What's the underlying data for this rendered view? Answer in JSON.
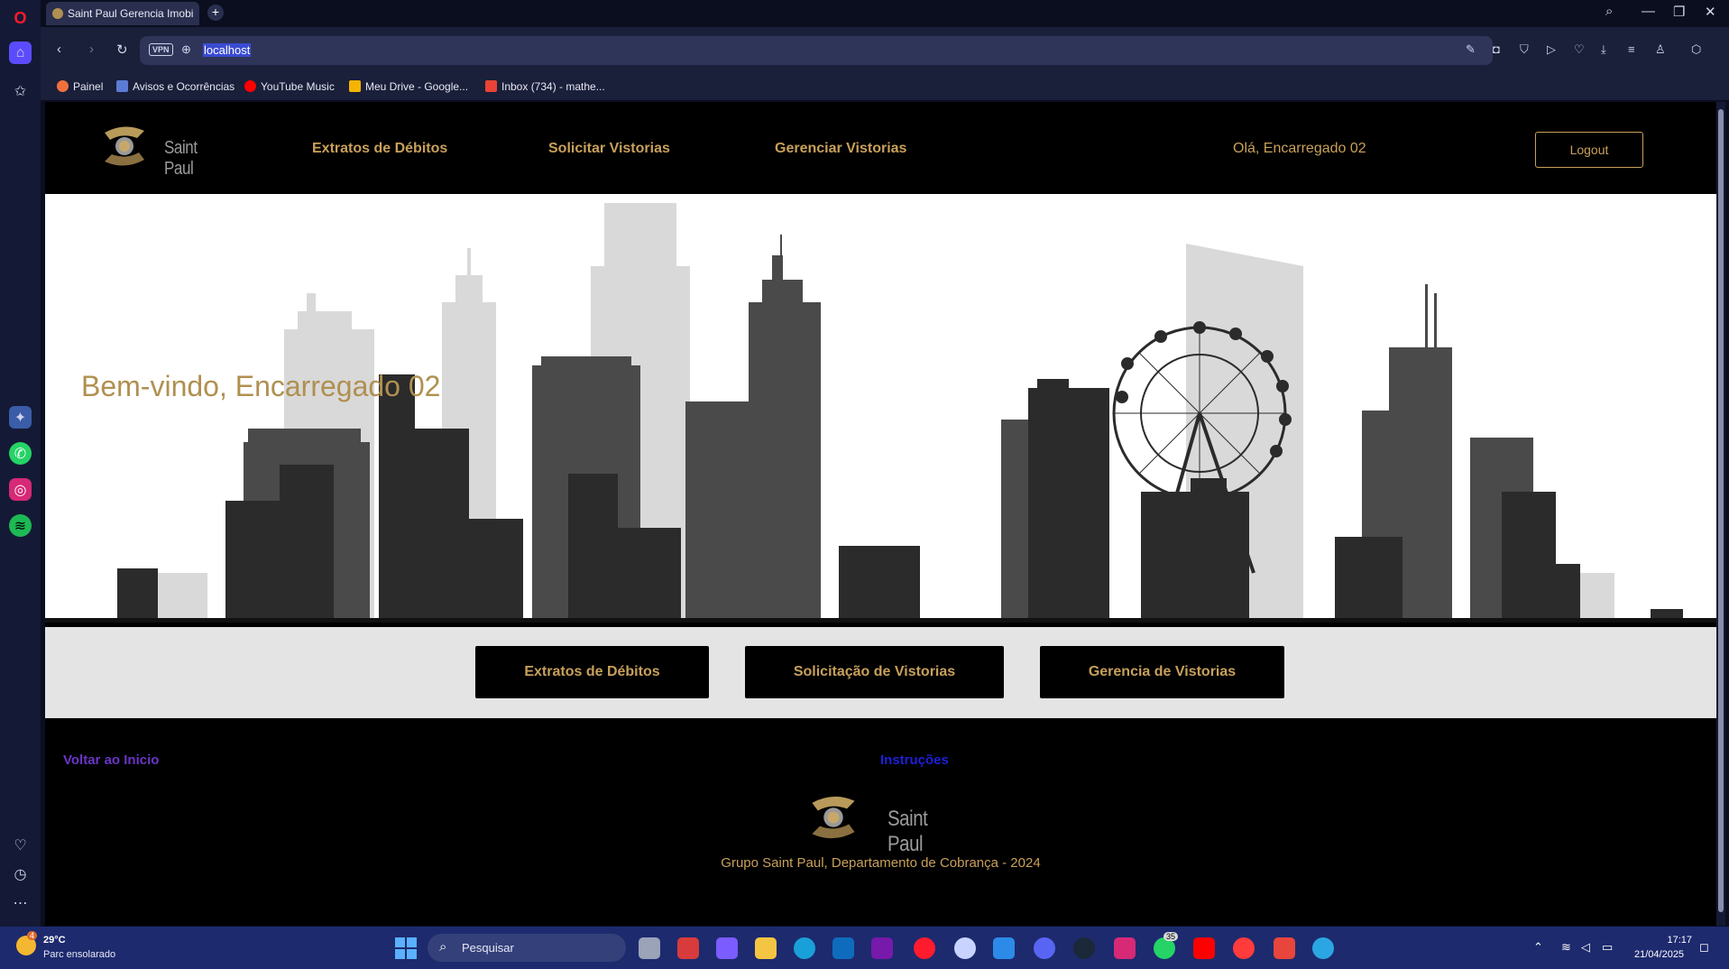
{
  "browser": {
    "tab_title": "Saint Paul Gerencia Imobi",
    "url": "localhost",
    "vpn_label": "VPN",
    "bookmarks": [
      "Painel",
      "Avisos e Ocorrências",
      "YouTube Music",
      "Meu Drive - Google...",
      "Inbox (734) - mathe..."
    ]
  },
  "header": {
    "logo_text": "Saint Paul",
    "nav": [
      "Extratos de Débitos",
      "Solicitar Vistorias",
      "Gerenciar Vistorias"
    ],
    "greeting": "Olá, Encarregado 02",
    "logout_label": "Logout"
  },
  "hero": {
    "welcome": "Bem-vindo, Encarregado 02"
  },
  "actions": [
    "Extratos de Débitos",
    "Solicitação de Vistorias",
    "Gerencia de Vistorias"
  ],
  "footer": {
    "back_link": "Voltar ao Inicio",
    "instructions_link": "Instruções",
    "logo_text": "Saint Paul",
    "copyright": "Grupo Saint Paul, Departamento de Cobrança - 2024"
  },
  "taskbar": {
    "weather_temp": "29°C",
    "weather_desc": "Parc ensolarado",
    "weather_badge": "4",
    "search_placeholder": "Pesquisar",
    "whatsapp_badge": "35",
    "time": "17:17",
    "date": "21/04/2025"
  },
  "colors": {
    "accent_gold": "#c8a05a",
    "page_bg": "#000000",
    "band_bg": "#e4e4e4"
  }
}
